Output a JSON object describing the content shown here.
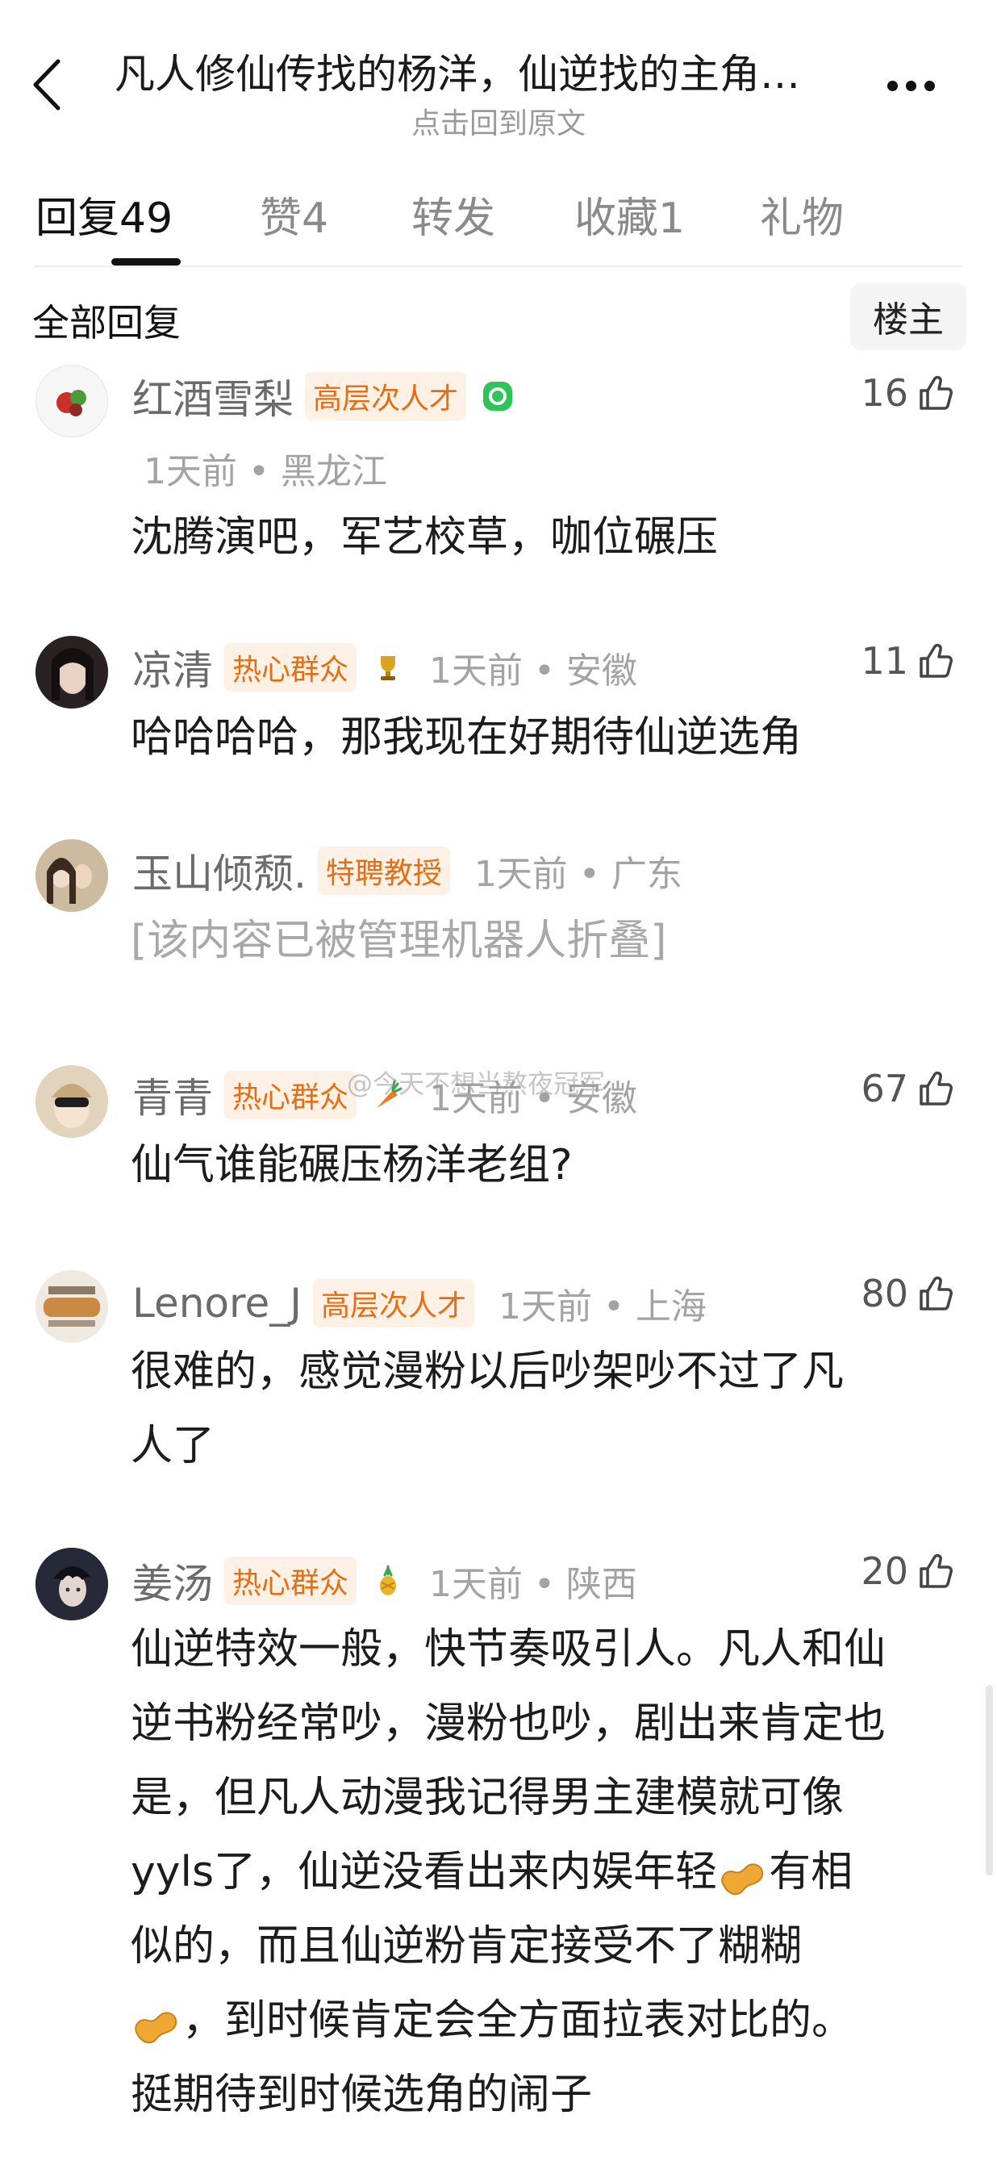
{
  "header": {
    "title": "凡人修仙传找的杨洋，仙逆找的主角…",
    "subtitle": "点击回到原文"
  },
  "tabs": [
    {
      "label": "回复",
      "count": "49"
    },
    {
      "label": "赞",
      "count": "4"
    },
    {
      "label": "转发",
      "count": ""
    },
    {
      "label": "收藏",
      "count": "1"
    },
    {
      "label": "礼物",
      "count": ""
    }
  ],
  "section": {
    "all_replies": "全部回复",
    "owner_filter": "楼主"
  },
  "watermark": "@今天不想当熬夜冠军",
  "comments": [
    {
      "name": "红酒雪梨",
      "badge": "高层次人才",
      "emblem": "green-emblem-icon",
      "time_location": "1天前 • 黑龙江",
      "likes": "16",
      "content": "沈腾演吧，军艺校草，咖位碾压"
    },
    {
      "name": "凉清",
      "badge": "热心群众",
      "emblem": "trophy-icon",
      "time_location": "1天前 • 安徽",
      "likes": "11",
      "content": "哈哈哈哈，那我现在好期待仙逆选角"
    },
    {
      "name": "玉山倾颓.",
      "badge": "特聘教授",
      "emblem": "",
      "time_location": "1天前 • 广东",
      "likes": "",
      "content": "[该内容已被管理机器人折叠]"
    },
    {
      "name": "青青",
      "badge": "热心群众",
      "emblem": "carrot-icon",
      "time_location": "1天前 • 安徽",
      "likes": "67",
      "content": "仙气谁能碾压杨洋老组?"
    },
    {
      "name": "Lenore_J",
      "badge": "高层次人才",
      "emblem": "",
      "time_location": "1天前 • 上海",
      "likes": "80",
      "content_lines": [
        "很难的，感觉漫粉以后吵架吵不过了凡",
        "人了"
      ]
    },
    {
      "name": "姜汤",
      "badge": "热心群众",
      "emblem": "pineapple-icon",
      "time_location": "1天前 • 陕西",
      "likes": "20",
      "content_lines": [
        "仙逆特效一般，快节奏吸引人。凡人和仙",
        "逆书粉经常吵，漫粉也吵，剧出来肯定也",
        "是，但凡人动漫我记得男主建模就可像",
        "yyls了，仙逆没看出来内娱年轻",
        "有相",
        "似的，而且仙逆粉肯定接受不了糊糊",
        "，到时候肯定会全方面拉表对比的。",
        "挺期待到时候选角的闹子"
      ]
    }
  ]
}
